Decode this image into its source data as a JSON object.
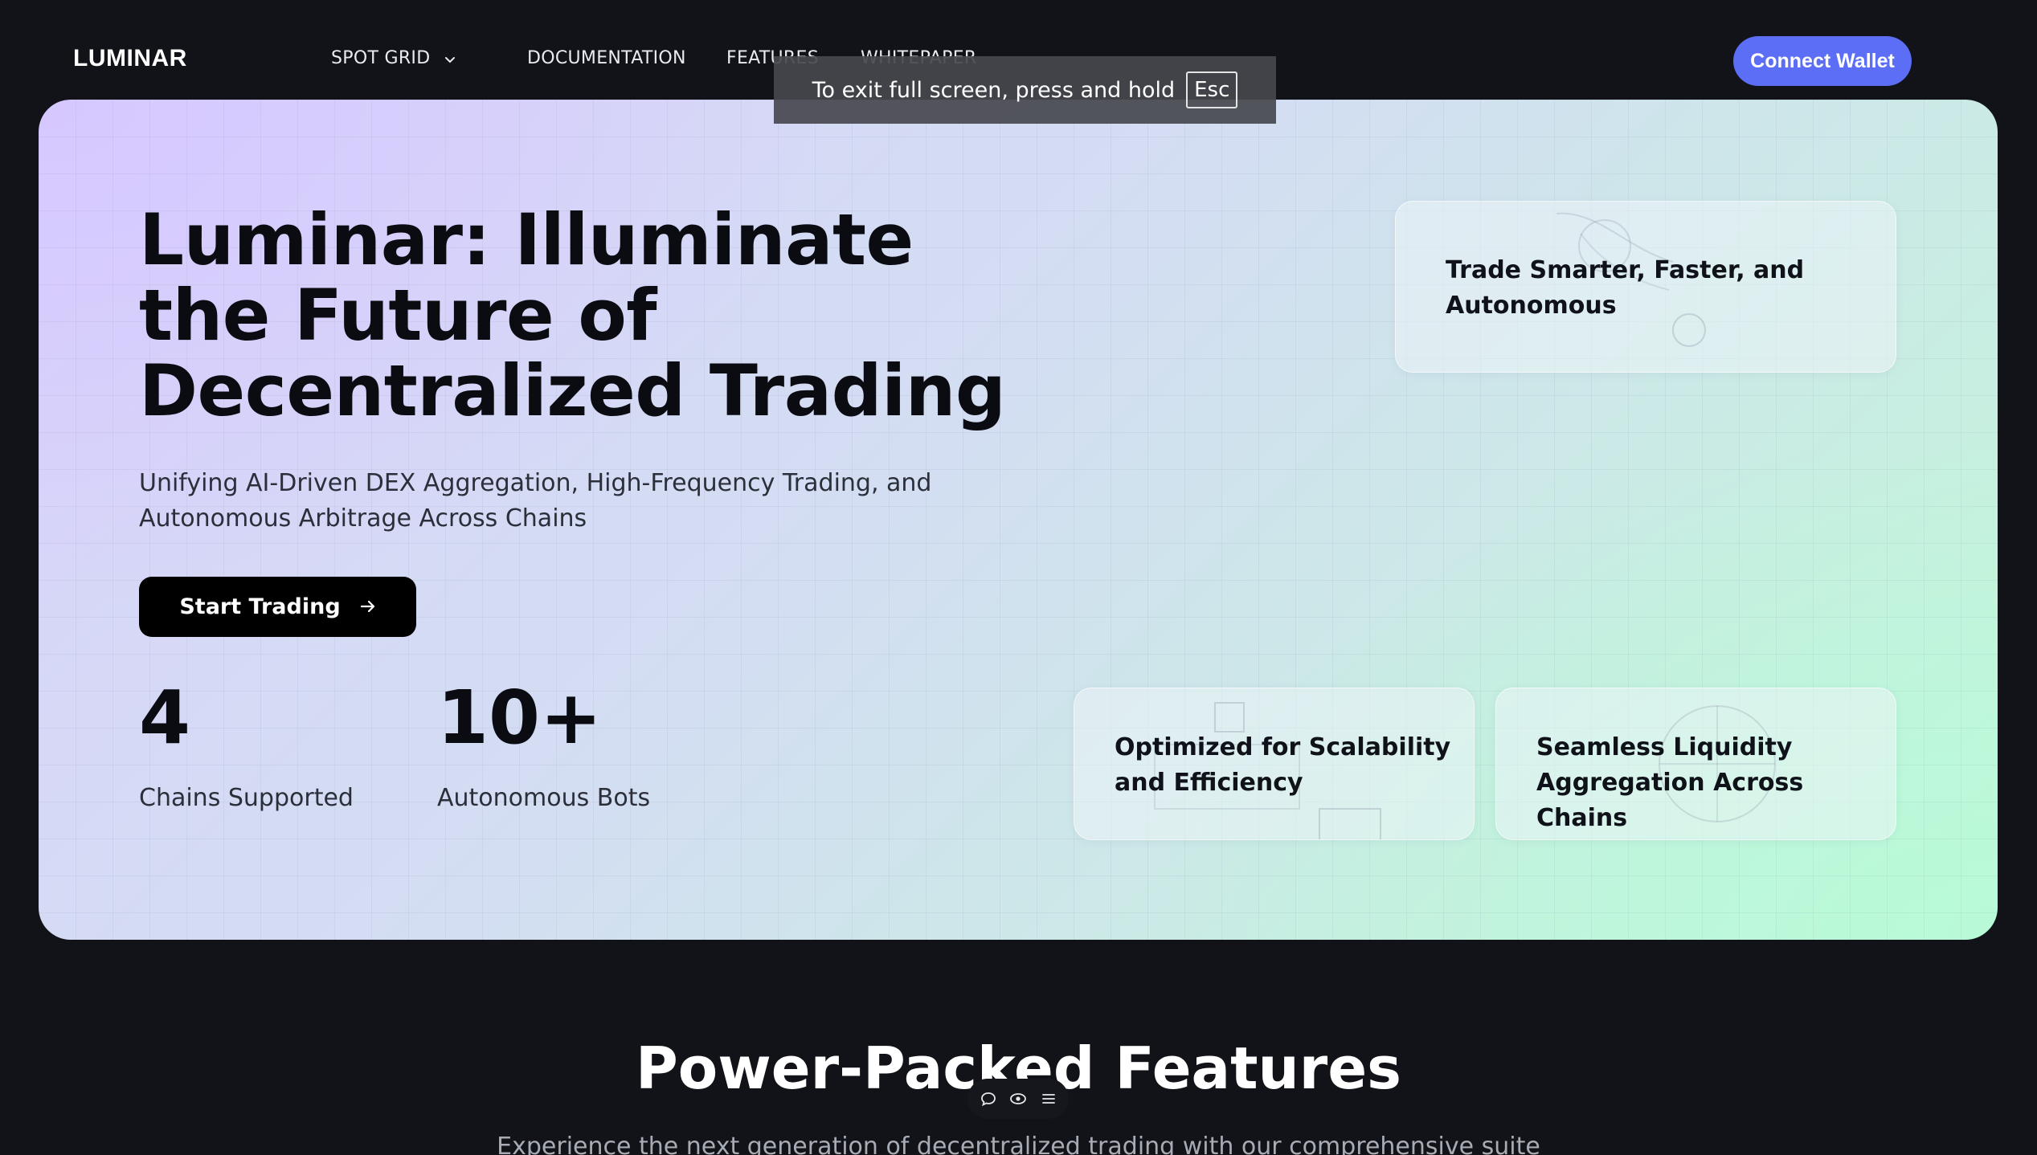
{
  "nav": {
    "logo": "LUMINAR",
    "links": [
      {
        "label": "SPOT GRID",
        "has_dropdown": true,
        "dropdown_icon": "chevron-down-icon"
      },
      {
        "label": "DOCUMENTATION"
      },
      {
        "label": "FEATURES"
      },
      {
        "label": "WHITEPAPER"
      }
    ],
    "connect_label": "Connect Wallet"
  },
  "fullscreen_notice": {
    "text": "To exit full screen, press and hold",
    "key": "Esc"
  },
  "hero": {
    "title": "Luminar: Illuminate the Future of Decentralized Trading",
    "subtitle": "Unifying AI-Driven DEX Aggregation, High-Frequency Trading, and Autonomous Arbitrage Across Chains",
    "cta_label": "Start Trading",
    "cta_icon": "arrow-right-icon",
    "stats": [
      {
        "value": "4",
        "label": "Chains Supported"
      },
      {
        "value": "10+",
        "label": "Autonomous Bots"
      }
    ],
    "cards": [
      {
        "text": "Trade Smarter, Faster, and Autonomous"
      },
      {
        "text": "Optimized for Scalability and Efficiency"
      },
      {
        "text": "Seamless Liquidity Aggregation Across Chains"
      }
    ]
  },
  "features": {
    "title": "Power-Packed Features",
    "subtitle": "Experience the next generation of decentralized trading with our comprehensive suite"
  },
  "floating_toolbar": {
    "icons": [
      "comment-icon",
      "eye-icon",
      "menu-icon"
    ]
  },
  "colors": {
    "page_bg": "#111318",
    "accent": "#5b6ef5",
    "hero_gradient_start": "#d6c8ff",
    "hero_gradient_end": "#b8fad8",
    "cta_bg": "#000000"
  }
}
